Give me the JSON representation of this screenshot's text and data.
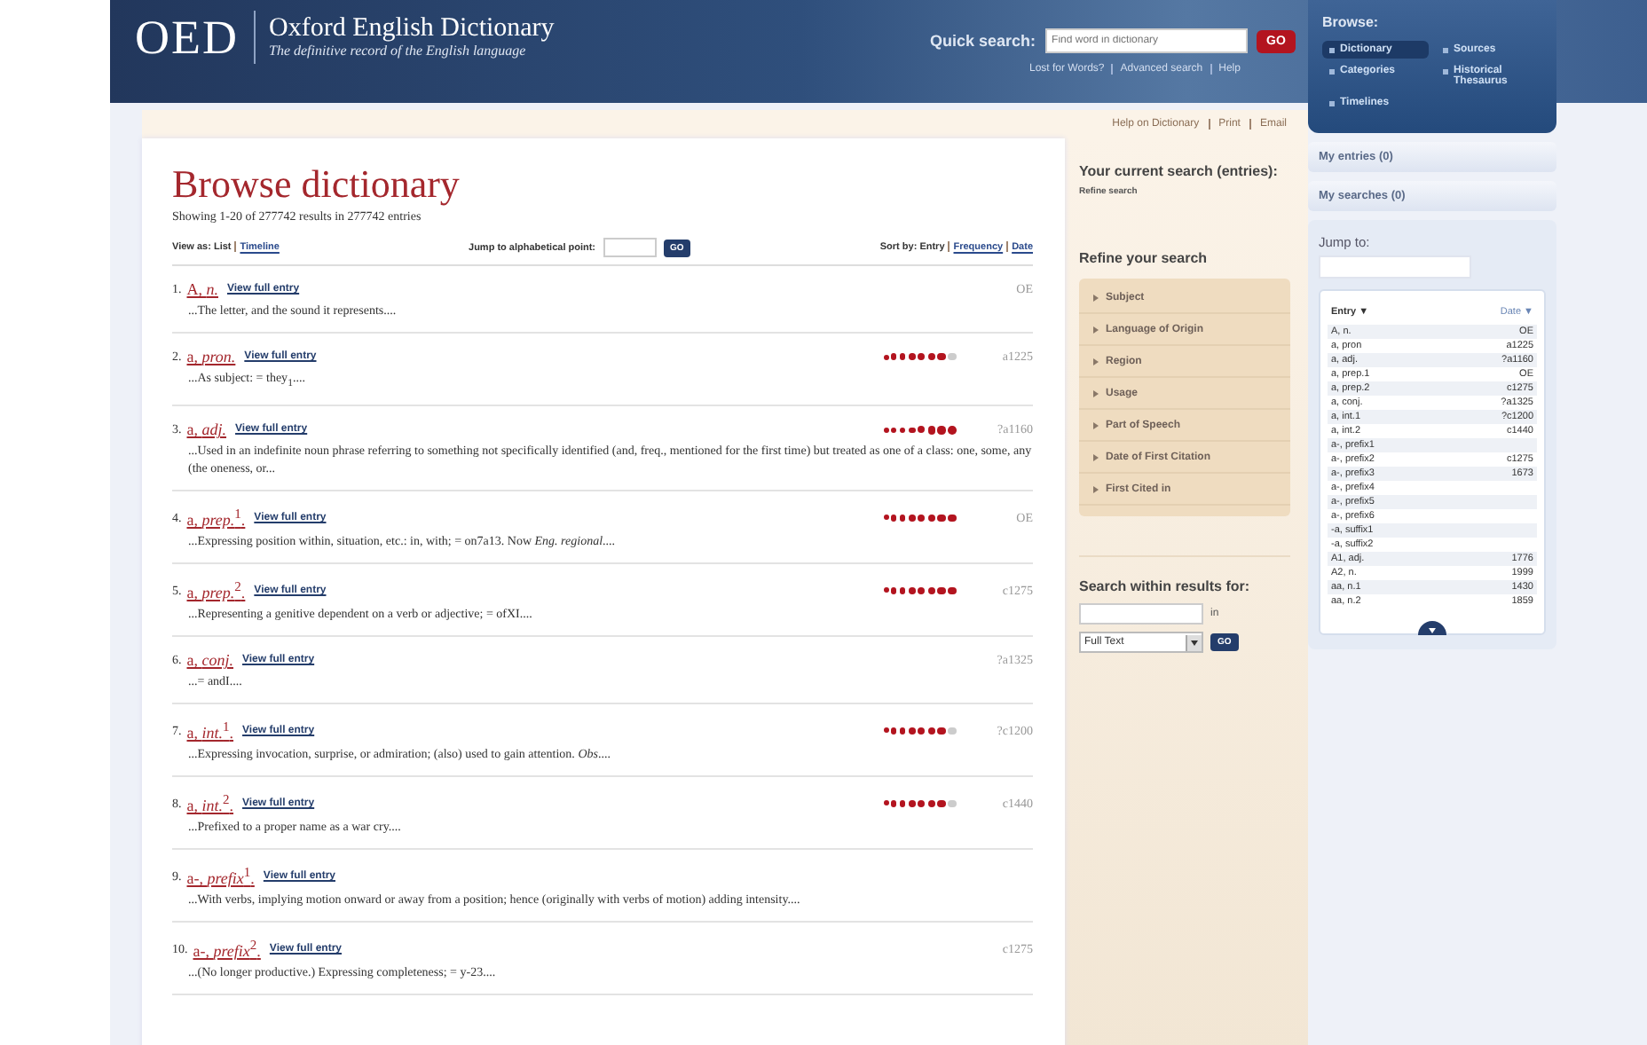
{
  "header": {
    "logo": "OED",
    "title": "Oxford English Dictionary",
    "tagline": "The definitive record of the English language",
    "quick_search": {
      "label": "Quick search:",
      "placeholder": "Find word in dictionary",
      "button": "GO"
    },
    "links": [
      "Lost for Words?",
      "Advanced search",
      "Help"
    ]
  },
  "browse": {
    "title": "Browse:",
    "items": [
      {
        "label": "Dictionary",
        "selected": true
      },
      {
        "label": "Sources",
        "selected": false
      },
      {
        "label": "Categories",
        "selected": false
      },
      {
        "label": "Historical Thesaurus",
        "selected": false
      },
      {
        "label": "Timelines",
        "selected": false
      }
    ]
  },
  "page_links": [
    "Help on Dictionary",
    "Print",
    "Email"
  ],
  "results": {
    "title": "Browse dictionary",
    "summary": "Showing 1-20 of 277742 results in 277742 entries",
    "view_as": {
      "label": "View as:",
      "options": [
        {
          "label": "List",
          "selected": true
        },
        {
          "label": "Timeline",
          "selected": false
        }
      ]
    },
    "jump": {
      "label": "Jump to alphabetical point:",
      "button": "GO"
    },
    "sort_by": {
      "label": "Sort by:",
      "options": [
        {
          "label": "Entry",
          "selected": true
        },
        {
          "label": "Frequency",
          "selected": false
        },
        {
          "label": "Date",
          "selected": false
        }
      ]
    },
    "entries": [
      {
        "number": "1.",
        "headword": "A, *n.*",
        "link": "View full entry",
        "date": "OE",
        "snippet": "...The letter, and the sound it represents...."
      },
      {
        "number": "2.",
        "headword": "a, *pron.*",
        "link": "View full entry",
        "date": "a1225",
        "stars": 7,
        "snippet": "...As subject: = they$_{1}$...."
      },
      {
        "number": "3.",
        "headword": "a, *adj.*",
        "link": "View full entry",
        "date": "?a1160",
        "stars": 8,
        "snippet": "...Used in an indefinite noun phrase referring to something not specifically identified (and, freq., mentioned for the first time) but treated as one of a class: one, some, any (the oneness, or..."
      },
      {
        "number": "4.",
        "headword": "a, *prep.*$^{1}$.",
        "link": "View full entry",
        "date": "OE",
        "stars": 8,
        "snippet": "...Expressing position within, situation, etc.: in, with; = on7a13. Now *Eng. regional*...."
      },
      {
        "number": "5.",
        "headword": "a, *prep.*$^{2}$.",
        "link": "View full entry",
        "date": "c1275",
        "stars": 8,
        "snippet": "...Representing a genitive dependent on a verb or adjective; = ofXI...."
      },
      {
        "number": "6.",
        "headword": "a, *conj.*",
        "link": "View full entry",
        "date": "?a1325",
        "snippet": "...= andI...."
      },
      {
        "number": "7.",
        "headword": "a, *int.*$^{1}$.",
        "link": "View full entry",
        "date": "?c1200",
        "stars": 7,
        "snippet": "...Expressing invocation, surprise, or admiration; (also) used to gain attention. *Obs*...."
      },
      {
        "number": "8.",
        "headword": "a, *int.*$^{2}$.",
        "link": "View full entry",
        "date": "c1440",
        "stars": 7,
        "snippet": "...Prefixed to a proper name as a war cry...."
      },
      {
        "number": "9.",
        "headword": "a-, *prefix*$^{1}$.",
        "link": "View full entry",
        "snippet": "...With verbs, implying motion onward or away from a position; hence (originally with verbs of motion) adding intensity...."
      },
      {
        "number": "10.",
        "headword": "a-, *prefix*$^{2}$.",
        "link": "View full entry",
        "date": "c1275",
        "snippet": "...(No longer productive.) Expressing completeness; = y-23...."
      }
    ]
  },
  "refine": {
    "current_title": "Your current search (entries):",
    "refine_link": "Refine search",
    "title": "Refine your search",
    "items": [
      "Subject",
      "Language of Origin",
      "Region",
      "Usage",
      "Part of Speech",
      "Date of First Citation",
      "First Cited in"
    ],
    "within": {
      "title": "Search within results for:",
      "in_label": "in",
      "select": "Full Text",
      "button": "GO"
    }
  },
  "sidebar": {
    "my_entries": "My entries (0)",
    "my_searches": "My searches (0)",
    "jump_title": "Jump to:",
    "columns": [
      "Entry ▼",
      "Date ▼"
    ],
    "rows": [
      {
        "entry": "A, n.",
        "date": "OE"
      },
      {
        "entry": "a, pron",
        "date": "a1225"
      },
      {
        "entry": "a, adj.",
        "date": "?a1160"
      },
      {
        "entry": "a, prep.1",
        "date": "OE"
      },
      {
        "entry": "a, prep.2",
        "date": "c1275"
      },
      {
        "entry": "a, conj.",
        "date": "?a1325"
      },
      {
        "entry": "a, int.1",
        "date": "?c1200"
      },
      {
        "entry": "a, int.2",
        "date": "c1440"
      },
      {
        "entry": "a-, prefix1"
      },
      {
        "entry": "a-, prefix2",
        "date": "c1275"
      },
      {
        "entry": "a-, prefix3",
        "date": "1673"
      },
      {
        "entry": "a-, prefix4"
      },
      {
        "entry": "a-, prefix5"
      },
      {
        "entry": "a-, prefix6"
      },
      {
        "entry": "-a, suffix1"
      },
      {
        "entry": "-a, suffix2"
      },
      {
        "entry": "A1, adj.",
        "date": "1776"
      },
      {
        "entry": "A2, n.",
        "date": "1999"
      },
      {
        "entry": "aa, n.1",
        "date": "1430"
      },
      {
        "entry": "aa, n.2",
        "date": "1859"
      }
    ]
  }
}
